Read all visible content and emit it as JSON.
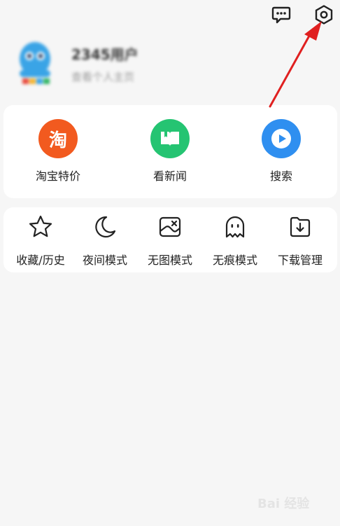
{
  "header": {
    "username": "2345用户",
    "subtitle": "查看个人主页"
  },
  "quick_actions": [
    {
      "label": "淘宝特价",
      "icon": "taobao-icon",
      "glyph": "淘",
      "color": "#f25a1f"
    },
    {
      "label": "看新闻",
      "icon": "news-book-icon",
      "color": "#25c472"
    },
    {
      "label": "搜索",
      "icon": "play-icon",
      "color": "#2f8ff0"
    }
  ],
  "tools": [
    {
      "label": "收藏/历史",
      "icon": "star-icon"
    },
    {
      "label": "夜间模式",
      "icon": "moon-icon"
    },
    {
      "label": "无图模式",
      "icon": "no-image-icon"
    },
    {
      "label": "无痕模式",
      "icon": "ghost-icon"
    },
    {
      "label": "下载管理",
      "icon": "download-folder-icon"
    }
  ],
  "watermark": {
    "text": "Bai 经验"
  },
  "colors": {
    "annotation_arrow": "#e02020",
    "background": "#f6f6f6"
  }
}
